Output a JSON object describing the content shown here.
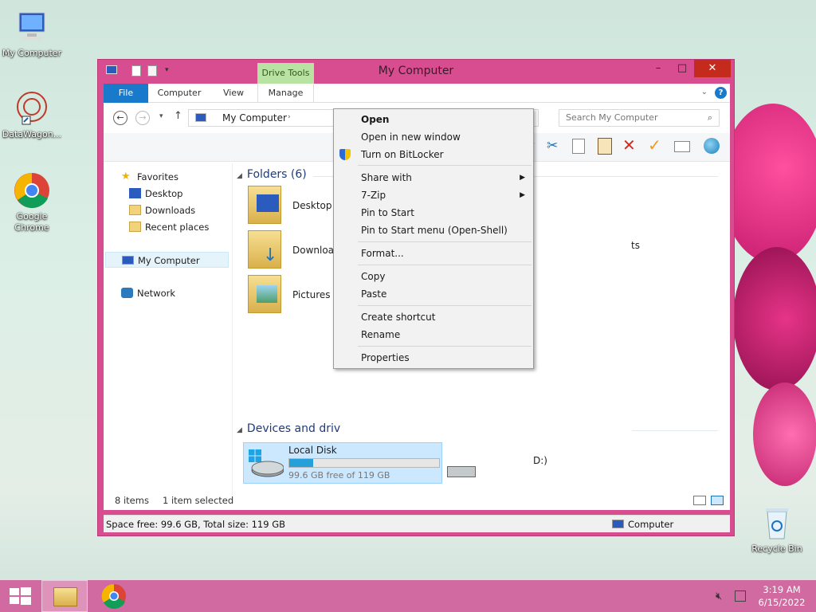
{
  "desktop": {
    "icons": [
      {
        "label": "My Computer"
      },
      {
        "label": "DataWagon..."
      },
      {
        "label": "Google Chrome"
      },
      {
        "label": "Recycle Bin"
      }
    ]
  },
  "window": {
    "title": "My Computer",
    "contextual_tab_group": "Drive Tools",
    "controls": {
      "minimize": "–",
      "maximize": "□",
      "close": "✕"
    }
  },
  "ribbon": {
    "tabs": [
      "File",
      "Computer",
      "View",
      "Manage"
    ]
  },
  "address_bar": {
    "path": "My Computer",
    "search_placeholder": "Search My Computer"
  },
  "nav_pane": {
    "favorites_label": "Favorites",
    "favorites_items": [
      "Desktop",
      "Downloads",
      "Recent places"
    ],
    "computer_label": "My Computer",
    "network_label": "Network"
  },
  "main": {
    "folders_header": "Folders (6)",
    "folders": [
      "Desktop",
      "Downloads",
      "Pictures"
    ],
    "folder_partial_right": "ts",
    "devices_header": "Devices and driv",
    "drive": {
      "name": "Local Disk",
      "free_text": "99.6 GB free of 119 GB",
      "used_fraction": 0.16
    },
    "drive2_partial": "D:)"
  },
  "status": {
    "item_count": "8 items",
    "selected": "1 item selected",
    "space": "Space free: 99.6 GB, Total size: 119 GB",
    "location": "Computer"
  },
  "context_menu": {
    "items": [
      {
        "label": "Open",
        "bold": true
      },
      {
        "label": "Open in new window"
      },
      {
        "label": "Turn on BitLocker"
      },
      {
        "label": "Share with",
        "submenu": true
      },
      {
        "label": "7-Zip",
        "submenu": true
      },
      {
        "label": "Pin to Start"
      },
      {
        "label": "Pin to Start menu (Open-Shell)"
      },
      {
        "label": "Format..."
      },
      {
        "label": "Copy"
      },
      {
        "label": "Paste"
      },
      {
        "label": "Create shortcut"
      },
      {
        "label": "Rename"
      },
      {
        "label": "Properties"
      }
    ]
  },
  "taskbar": {
    "time": "3:19 AM",
    "date": "6/15/2022"
  },
  "colors": {
    "window_frame": "#d84d8f",
    "file_tab": "#1979ca",
    "drive_tools": "#b9e3a3",
    "taskbar": "#d06aa0"
  }
}
